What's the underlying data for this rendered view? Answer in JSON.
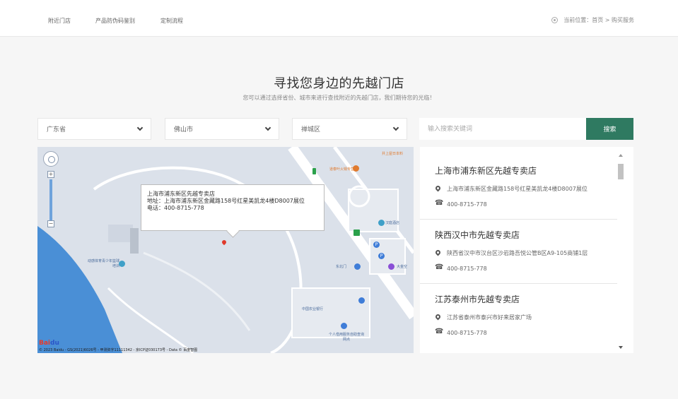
{
  "nav": {
    "items": [
      "附近门店",
      "产品防伪码鉴别",
      "定制流程"
    ]
  },
  "location": {
    "text": "当前位置：首页 > 购买服务"
  },
  "header": {
    "title": "寻找您身边的先越门店",
    "subtitle": "您可以通过选择省份、城市来进行查找附近的先越门店，我们期待您的光临！"
  },
  "filters": {
    "province": "广东省",
    "city": "佛山市",
    "district": "禅城区",
    "search_placeholder": "输入搜索关键词",
    "search_button": "搜索"
  },
  "map": {
    "info": {
      "name": "上海市浦东新区先越专卖店",
      "address": "地址：上海市浦东新区金藏路158号红星美凯龙4楼D8007展位",
      "phone": "电话：400-8715-778"
    },
    "labels": {
      "a": "道泰叶火锅专营店",
      "b": "井上屋日本料",
      "c": "汉庭酒店",
      "d": "动感体育青少年篮球培训",
      "e": "东北门",
      "f": "大金空",
      "g": "中国农业银行",
      "h": "个人借用服务自助查询网点"
    },
    "copyright": "© 2023 Baidu - GS(2021)6026号 - 甲测资字11111342 - 京ICP证030173号 - Data © 百度智图",
    "logo_a": "Bai",
    "logo_b": "du"
  },
  "stores": [
    {
      "name": "上海市浦东新区先越专卖店",
      "address": "上海市浦东新区金藏路158号红星美凯龙4楼D8007展位",
      "phone": "400-8715-778"
    },
    {
      "name": "陕西汉中市先越专卖店",
      "address": "陕西省汉中市汉台区沙岩路吾悦公管B区A9-105商铺1层",
      "phone": "400-8715-778"
    },
    {
      "name": "江苏泰州市先越专卖店",
      "address": "江苏省泰州市泰兴市好来居家广场",
      "phone": "400-8715-778"
    }
  ],
  "colors": {
    "accent": "#2f7a61",
    "map_bg": "#dbe1ea",
    "water": "#4a8fd6"
  }
}
